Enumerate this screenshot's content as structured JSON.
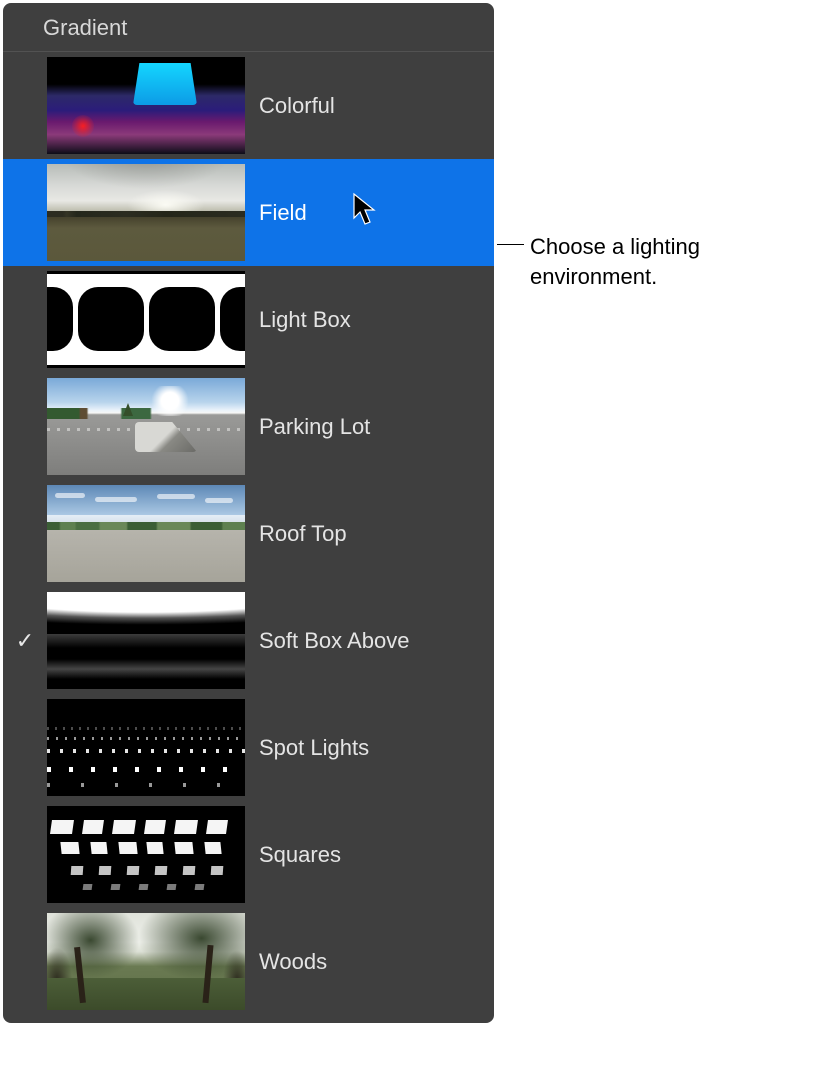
{
  "panel": {
    "header": "Gradient",
    "highlighted_index": 1,
    "checked_index": 5,
    "items": [
      {
        "label": "Colorful",
        "thumb": "colorful"
      },
      {
        "label": "Field",
        "thumb": "field"
      },
      {
        "label": "Light Box",
        "thumb": "lightbox"
      },
      {
        "label": "Parking Lot",
        "thumb": "parkinglot"
      },
      {
        "label": "Roof Top",
        "thumb": "rooftop"
      },
      {
        "label": "Soft Box Above",
        "thumb": "softbox"
      },
      {
        "label": "Spot Lights",
        "thumb": "spotlights"
      },
      {
        "label": "Squares",
        "thumb": "squares"
      },
      {
        "label": "Woods",
        "thumb": "woods"
      }
    ]
  },
  "callout": {
    "text": "Choose a lighting environment."
  },
  "checkmark_glyph": "✓"
}
